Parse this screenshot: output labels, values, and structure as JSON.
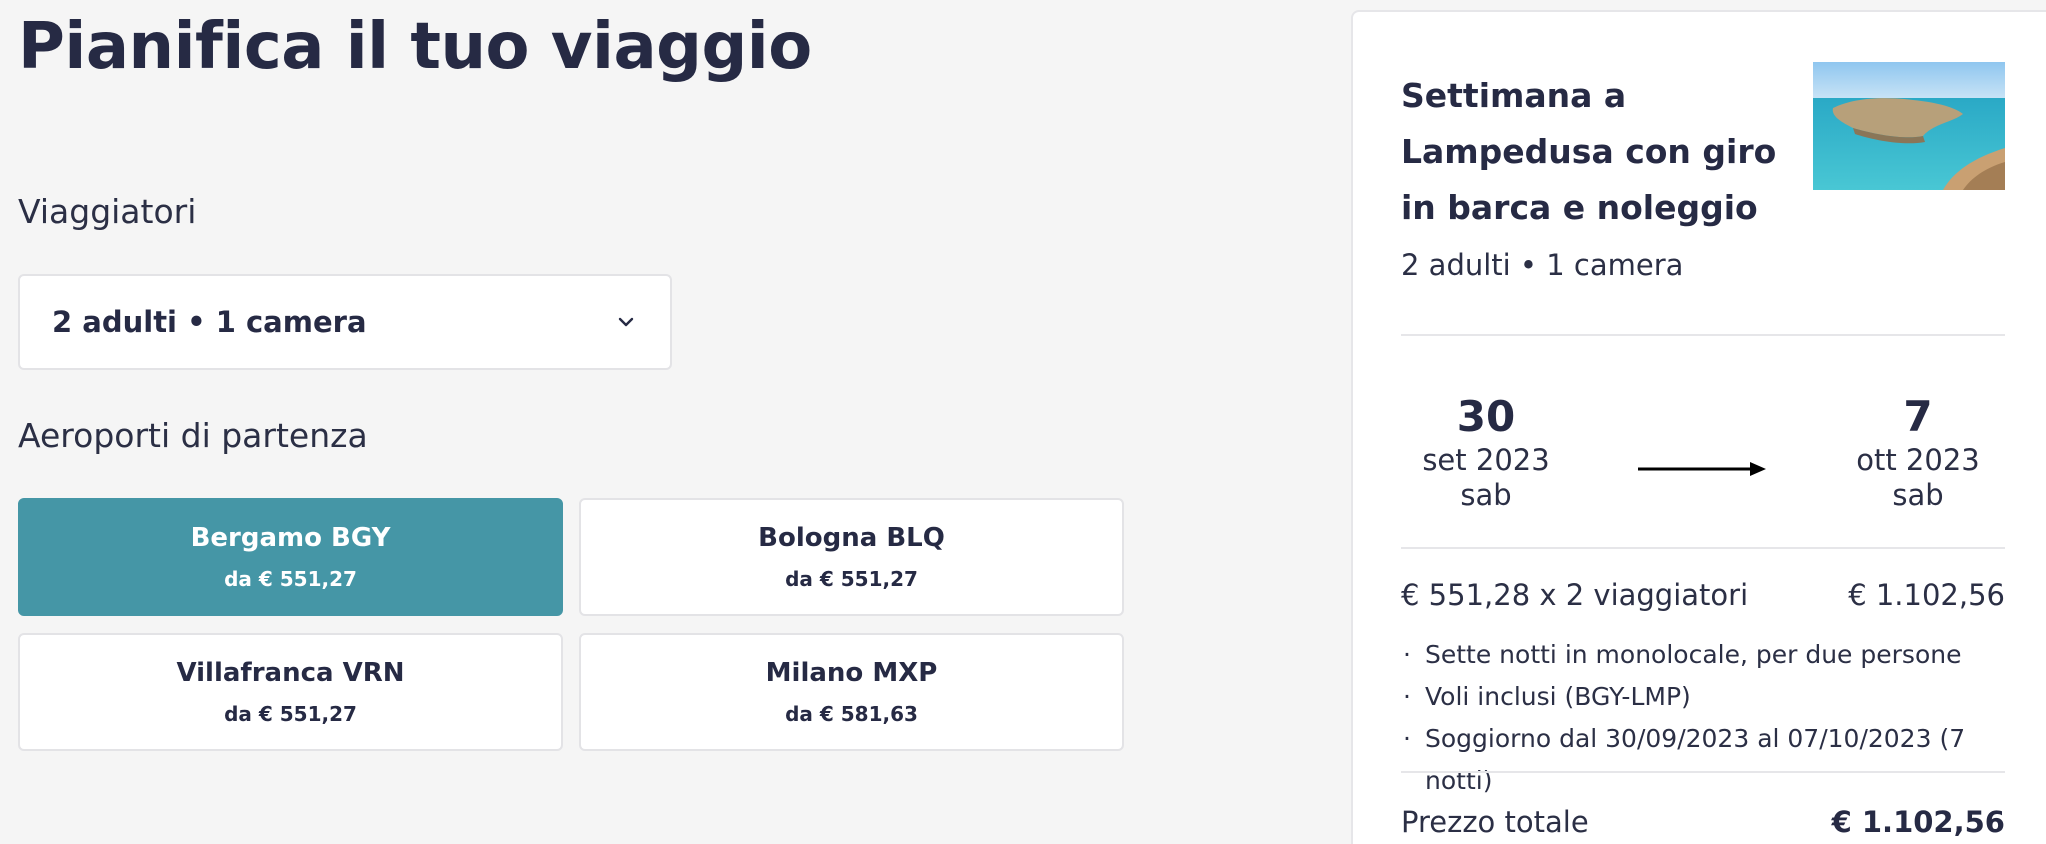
{
  "page": {
    "title": "Pianifica il tuo viaggio"
  },
  "travellers": {
    "label": "Viaggiatori",
    "value": "2 adulti • 1 camera",
    "icon": "chevron-down-icon"
  },
  "airports": {
    "label": "Aeroporti di partenza",
    "items": [
      {
        "name": "Bergamo BGY",
        "price": "da € 551,27",
        "selected": true
      },
      {
        "name": "Bologna BLQ",
        "price": "da € 551,27",
        "selected": false
      },
      {
        "name": "Villafranca VRN",
        "price": "da € 551,27",
        "selected": false
      },
      {
        "name": "Milano MXP",
        "price": "da € 581,63",
        "selected": false
      }
    ]
  },
  "summary": {
    "title": "Settimana a Lampedusa con giro in barca e noleggio",
    "subtitle": "2 adulti • 1 camera",
    "start": {
      "day": "30",
      "month": "set 2023",
      "weekday": "sab"
    },
    "end": {
      "day": "7",
      "month": "ott 2023",
      "weekday": "sab"
    },
    "price_line": {
      "label": "€ 551,28 x 2 viaggiatori",
      "value": "€ 1.102,56"
    },
    "bullets": [
      "Sette notti in monolocale, per due persone",
      "Voli inclusi (BGY-LMP)",
      "Soggiorno dal 30/09/2023 al 07/10/2023 (7 notti)"
    ],
    "total": {
      "label": "Prezzo totale",
      "value": "€ 1.102,56"
    }
  },
  "colors": {
    "accent": "#4596a6",
    "text": "#262a44",
    "background": "#f5f5f5"
  }
}
